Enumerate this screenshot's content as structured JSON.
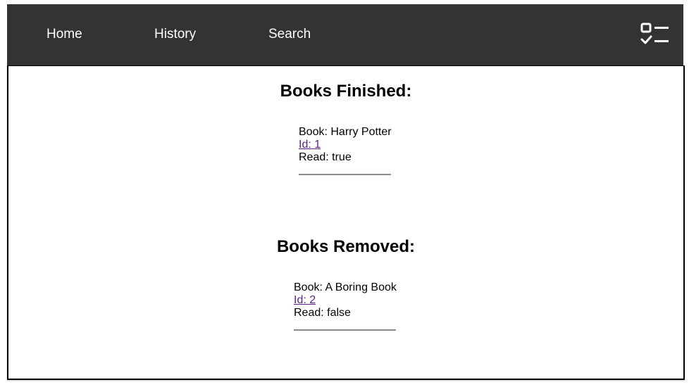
{
  "nav": {
    "home_label": "Home",
    "history_label": "History",
    "search_label": "Search",
    "menu_icon": "checklist-icon",
    "background_color": "#333333",
    "text_color": "#ffffff"
  },
  "sections": {
    "finished": {
      "title": "Books Finished:",
      "books": [
        {
          "book": "Book: Harry Potter",
          "id": "Id: 1",
          "read": "Read: true"
        }
      ]
    },
    "removed": {
      "title": "Books Removed:",
      "books": [
        {
          "book": "Book: A Boring Book",
          "id": "Id: 2",
          "read": "Read: false"
        }
      ]
    }
  },
  "colors": {
    "link": "#5b1f8f",
    "divider": "#8a8a8a"
  }
}
